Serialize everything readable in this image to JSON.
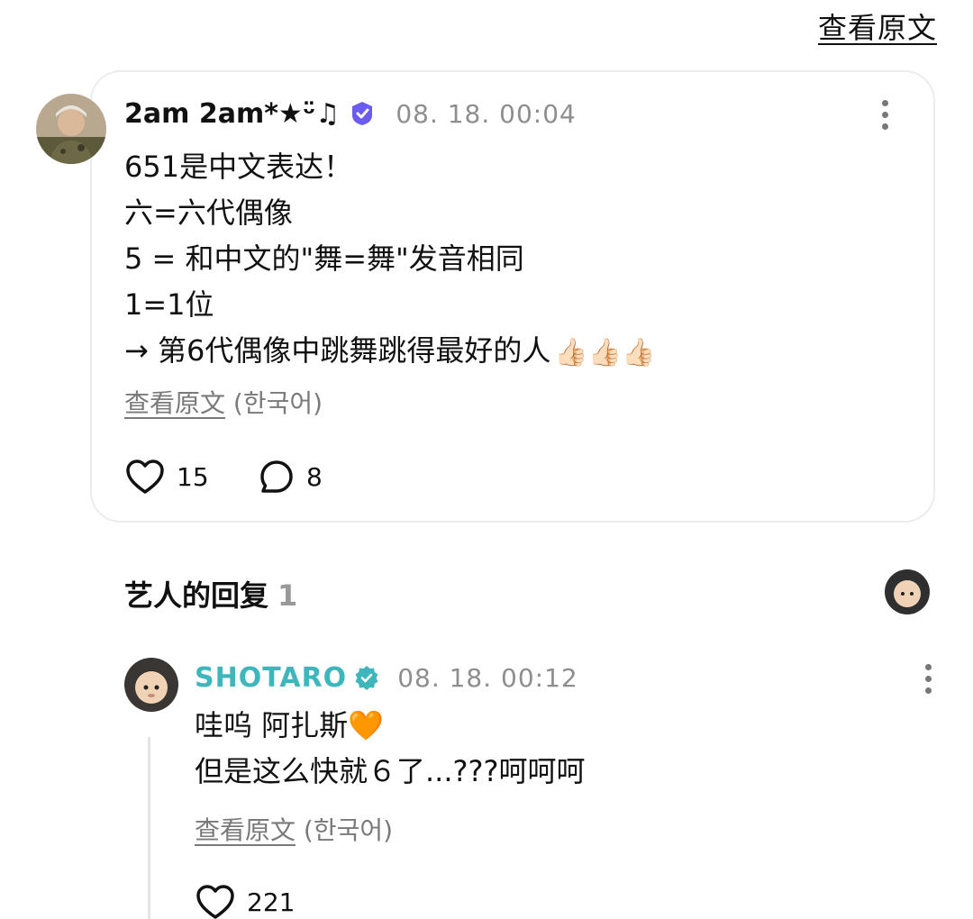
{
  "header": {
    "see_original_label": "查看原文"
  },
  "post": {
    "username": "2am 2am*★ᵕ̈♫",
    "timestamp": "08. 18. 00:04",
    "lines": [
      "651是中文表达！",
      "六=六代偶像",
      "5 = 和中文的\"舞=舞\"发音相同",
      "1=1位",
      "→ 第6代偶像中跳舞跳得最好的人"
    ],
    "line_emoji": "👍🏻👍🏻👍🏻",
    "see_original": "查看原文",
    "see_original_lang": "(한국어)",
    "likes": "15",
    "comments": "8"
  },
  "artist_replies": {
    "title": "艺人的回复",
    "count": "1"
  },
  "reply": {
    "username": "SHOTARO",
    "timestamp": "08. 18. 00:12",
    "lines": [
      "哇呜 阿扎斯🧡",
      "但是这么快就６了...???呵呵呵"
    ],
    "see_original": "查看原文",
    "see_original_lang": "(한국어)",
    "likes": "221"
  },
  "icons": {
    "verified_post": "verified-badge-purple",
    "verified_artist": "verified-badge-teal",
    "like": "heart-icon",
    "comment": "comment-bubble-icon",
    "more": "more-vertical-icon"
  },
  "colors": {
    "artist_name": "#3fb6bc",
    "verified_purple": "#6a5cf0",
    "muted_text": "#8e8e8e"
  }
}
